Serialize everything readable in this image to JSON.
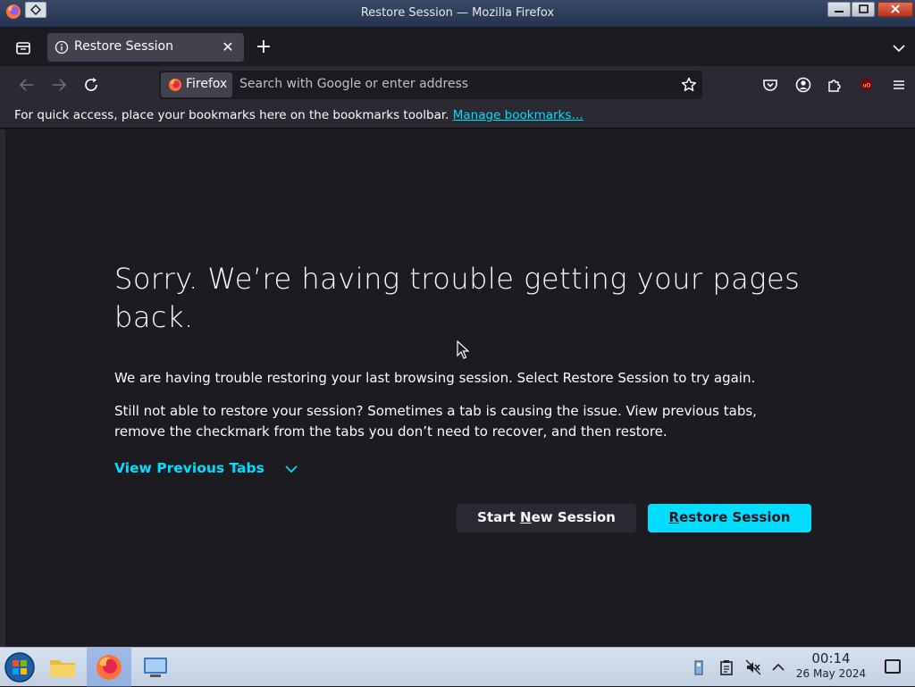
{
  "window": {
    "title": "Restore Session — Mozilla Firefox"
  },
  "tabs": [
    {
      "label": "Restore Session",
      "active": true
    }
  ],
  "urlbar": {
    "identity_label": "Firefox",
    "placeholder": "Search with Google or enter address"
  },
  "bookmarks_toolbar": {
    "message": "For quick access, place your bookmarks here on the bookmarks toolbar.",
    "link": "Manage bookmarks…"
  },
  "page": {
    "heading": "Sorry. We’re having trouble getting your pages back.",
    "paragraph1": "We are having trouble restoring your last browsing session. Select Restore Session to try again.",
    "paragraph2": "Still not able to restore your session? Sometimes a tab is causing the issue. View previous tabs, remove the checkmark from the tabs you don’t need to recover, and then restore.",
    "view_previous_tabs": "View Previous Tabs",
    "start_new_session": {
      "before": "Start ",
      "accesskey": "N",
      "after": "ew Session"
    },
    "restore_session": {
      "before": "",
      "accesskey": "R",
      "after": "estore Session"
    }
  },
  "taskbar": {
    "apps": [
      "file-manager",
      "firefox",
      "system-settings"
    ],
    "active_app": "firefox",
    "time": "00:14",
    "date": "26 May 2024"
  },
  "colors": {
    "accent": "#00ddff",
    "page_bg": "#1c1b22",
    "toolbar_bg": "#2b2a33",
    "tab_bg": "#42414d",
    "text": "#fbfbfe"
  }
}
